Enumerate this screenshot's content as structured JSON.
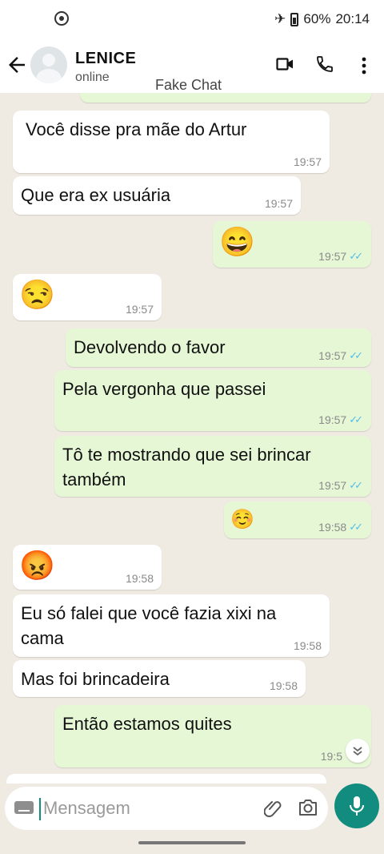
{
  "status": {
    "battery": "60%",
    "time": "20:14"
  },
  "header": {
    "name": "LENICE",
    "status": "online",
    "watermark": "Fake Chat"
  },
  "messages": [
    {
      "side": "in",
      "text": "Você disse pra mãe do Artur",
      "time": "19:57"
    },
    {
      "side": "in",
      "text": "Que era ex usuária",
      "time": "19:57"
    },
    {
      "side": "out",
      "emoji": "😄",
      "time": "19:57"
    },
    {
      "side": "in",
      "emoji": "😒",
      "time": "19:57"
    },
    {
      "side": "out",
      "text": "Devolvendo o favor",
      "time": "19:57"
    },
    {
      "side": "out",
      "text": "Pela vergonha que passei",
      "time": "19:57"
    },
    {
      "side": "out",
      "text": "Tô te mostrando que sei brincar\ntambém",
      "time": "19:57"
    },
    {
      "side": "out",
      "emoji": "☺️",
      "time": "19:58"
    },
    {
      "side": "in",
      "emoji": "😡",
      "time": "19:58"
    },
    {
      "side": "in",
      "text": "Eu só falei que você fazia xixi na\ncama",
      "time": "19:58"
    },
    {
      "side": "in",
      "text": "Mas foi brincadeira",
      "time": "19:58"
    },
    {
      "side": "out",
      "text": "Então estamos quites",
      "time": "19:5"
    }
  ],
  "composer": {
    "placeholder": "Mensagem"
  },
  "colors": {
    "incoming": "#ffffff",
    "outgoing": "#e6f7d6",
    "accent": "#128c7e",
    "read_ticks": "#53bdeb",
    "background": "#efeae2"
  },
  "icons": [
    "back-arrow-icon",
    "video-call-icon",
    "phone-icon",
    "more-vert-icon",
    "keyboard-icon",
    "attach-icon",
    "camera-icon",
    "mic-icon",
    "chevron-down-icon"
  ]
}
